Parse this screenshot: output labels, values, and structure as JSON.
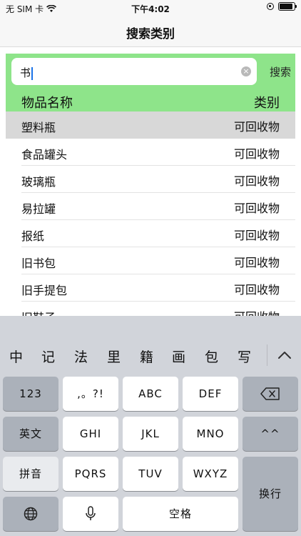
{
  "status_bar": {
    "carrier": "无 SIM 卡",
    "time": "下午4:02"
  },
  "nav": {
    "title": "搜索类别"
  },
  "search": {
    "value": "书",
    "button_label": "搜索",
    "clear_glyph": "×"
  },
  "list": {
    "headers": {
      "name": "物品名称",
      "category": "类别"
    },
    "rows": [
      {
        "name": "塑料瓶",
        "category": "可回收物"
      },
      {
        "name": "食品罐头",
        "category": "可回收物"
      },
      {
        "name": "玻璃瓶",
        "category": "可回收物"
      },
      {
        "name": "易拉罐",
        "category": "可回收物"
      },
      {
        "name": "报纸",
        "category": "可回收物"
      },
      {
        "name": "旧书包",
        "category": "可回收物"
      },
      {
        "name": "旧手提包",
        "category": "可回收物"
      },
      {
        "name": "旧鞋子",
        "category": "可回收物"
      }
    ]
  },
  "keyboard": {
    "candidates": [
      "中",
      "记",
      "法",
      "里",
      "籍",
      "画",
      "包",
      "写"
    ],
    "keys": {
      "num": "123",
      "punct": ",。?!",
      "abc": "ABC",
      "def": "DEF",
      "en": "英文",
      "ghi": "GHI",
      "jkl": "JKL",
      "mno": "MNO",
      "emoji": "^^",
      "pinyin": "拼音",
      "pqrs": "PQRS",
      "tuv": "TUV",
      "wxyz": "WXYZ",
      "return": "换行",
      "space": "空格"
    },
    "icons": [
      "chevron-up-icon",
      "backspace-icon",
      "globe-icon",
      "microphone-icon"
    ]
  },
  "colors": {
    "accent_green": "#8ee48a",
    "selected_row": "#d8d8d8",
    "keyboard_bg": "#d1d4da",
    "function_key": "#abb1ba"
  }
}
